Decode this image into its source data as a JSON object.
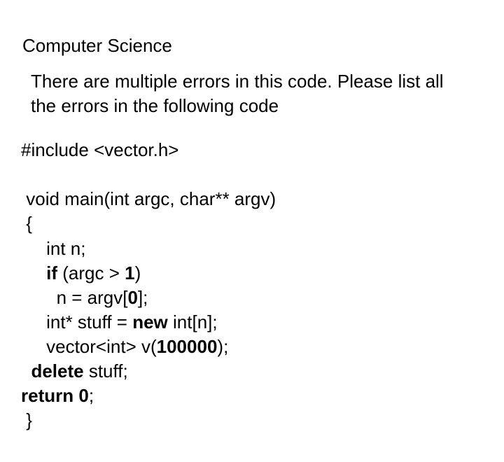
{
  "subject": "Computer Science",
  "question": "There are multiple errors in this code. Please list all the errors in the following code",
  "code": {
    "line1": "#include <vector.h>",
    "line3": "void main(int argc, char** argv)",
    "line4": "{",
    "line5_pre": "     int n;",
    "line6_pre": "     ",
    "line6_if": "if",
    "line6_post_if": " (argc > ",
    "line6_num": "1",
    "line6_close": ")",
    "line7_pre": "       n = argv[",
    "line7_num": "0",
    "line7_close": "];",
    "line8_pre": "     int* stuff = ",
    "line8_new": "new",
    "line8_post": " int[n];",
    "line9_pre": "     vector<int> v(",
    "line9_num": "100000",
    "line9_close": ");",
    "line10_pre": "  ",
    "line10_del": "delete",
    "line10_post": " stuff;",
    "line11_ret": "return",
    "line11_sp": " ",
    "line11_num": "0",
    "line11_close": ";",
    "line12": " }"
  }
}
